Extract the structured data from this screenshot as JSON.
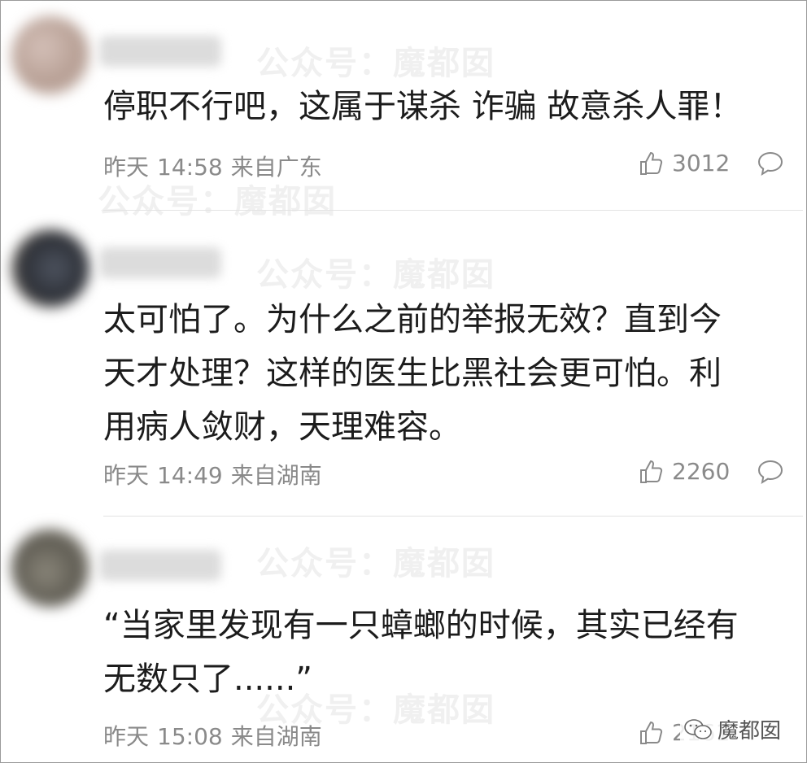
{
  "watermark": "公众号：魔都囡",
  "comments": [
    {
      "text": "停职不行吧，这属于谋杀 诈骗 故意杀人罪！",
      "day": "昨天",
      "time": "14:58",
      "location": "来自广东",
      "likes": "3012"
    },
    {
      "text": "太可怕了。为什么之前的举报无效？直到今\n天才处理？这样的医生比黑社会更可怕。利\n用病人敛财，天理难容。",
      "day": "昨天",
      "time": "14:49",
      "location": "来自湖南",
      "likes": "2260"
    },
    {
      "text": "“当家里发现有一只蟑螂的时候，其实已经有\n无数只了......”",
      "day": "昨天",
      "time": "15:08",
      "location": "来自湖南",
      "likes": "2161"
    }
  ],
  "corner_watermark": "魔都囡",
  "colors": {
    "text": "#1c1c1c",
    "meta": "#8a8a8a",
    "divider": "#e3e3e3",
    "watermark": "#f0f0f0"
  },
  "icons": [
    "thumbs-up-icon",
    "comment-bubble-icon",
    "wechat-icon"
  ]
}
